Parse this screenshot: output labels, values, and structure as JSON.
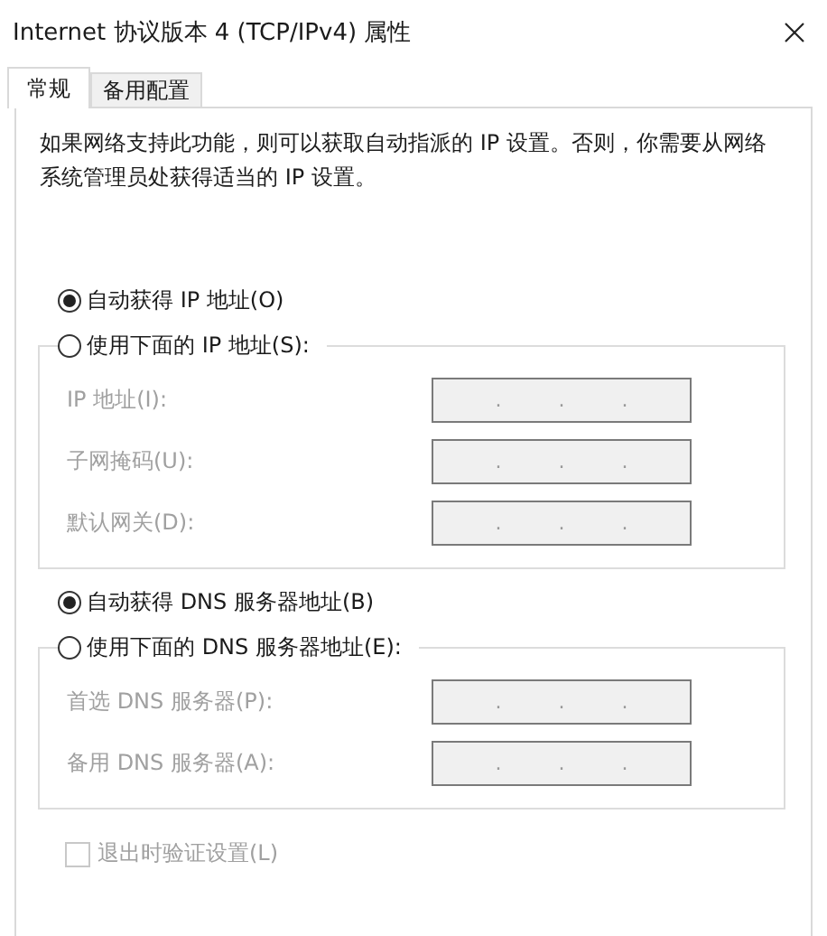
{
  "window": {
    "title": "Internet 协议版本 4 (TCP/IPv4) 属性"
  },
  "tabs": [
    {
      "label": "常规",
      "selected": true
    },
    {
      "label": "备用配置",
      "selected": false
    }
  ],
  "description": "如果网络支持此功能，则可以获取自动指派的 IP 设置。否则，你需要从网络系统管理员处获得适当的 IP 设置。",
  "sections": [
    {
      "auto_option": {
        "label": "自动获得 IP 地址(O)",
        "selected": true
      },
      "manual_option": {
        "label": "使用下面的 IP 地址(S):",
        "selected": false
      },
      "fields": [
        {
          "label": "IP 地址(I):",
          "value": ". . .",
          "disabled": true
        },
        {
          "label": "子网掩码(U):",
          "value": ". . .",
          "disabled": true
        },
        {
          "label": "默认网关(D):",
          "value": ". . .",
          "disabled": true
        }
      ]
    },
    {
      "auto_option": {
        "label": "自动获得 DNS 服务器地址(B)",
        "selected": true
      },
      "manual_option": {
        "label": "使用下面的 DNS 服务器地址(E):",
        "selected": false
      },
      "fields": [
        {
          "label": "首选 DNS 服务器(P):",
          "value": ". . .",
          "disabled": true
        },
        {
          "label": "备用 DNS 服务器(A):",
          "value": ". . .",
          "disabled": true
        }
      ]
    }
  ],
  "validate_checkbox": {
    "label": "退出时验证设置(L)",
    "checked": false,
    "disabled": true
  }
}
